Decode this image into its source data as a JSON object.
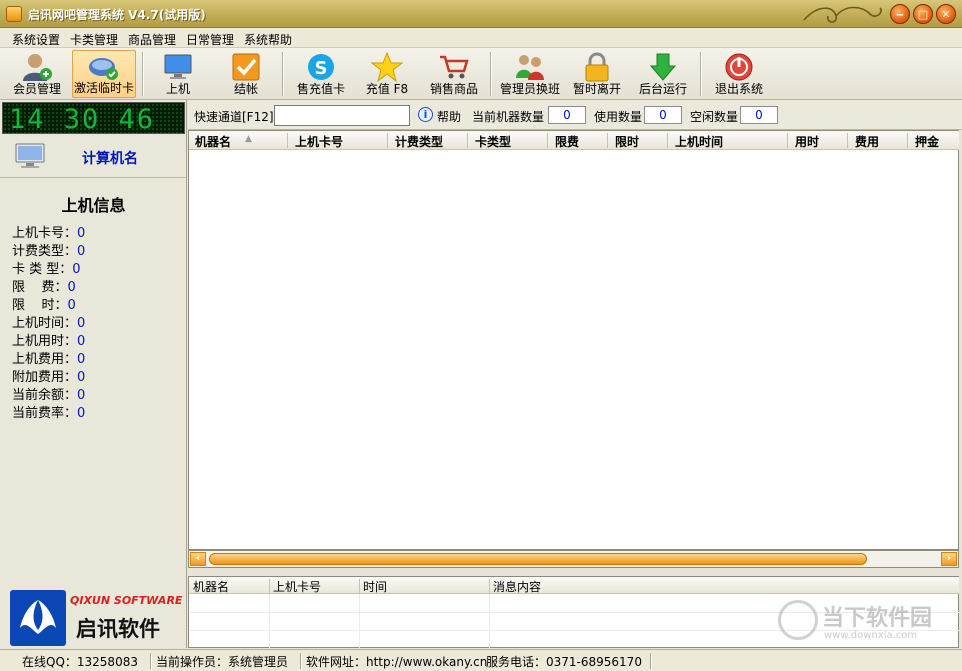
{
  "window": {
    "title": "启讯网吧管理系统 V4.7(试用版)"
  },
  "menu": {
    "items": [
      "系统设置",
      "卡类管理",
      "商品管理",
      "日常管理",
      "系统帮助"
    ]
  },
  "toolbar": {
    "buttons": [
      {
        "label": "会员管理",
        "icon": "member-icon"
      },
      {
        "label": "激活临时卡",
        "icon": "temp-card-icon"
      },
      {
        "label": "上机",
        "icon": "monitor-icon"
      },
      {
        "label": "结帐",
        "icon": "checkout-icon"
      },
      {
        "label": "售充值卡",
        "icon": "skype-icon"
      },
      {
        "label": "充值 F8",
        "icon": "star-icon"
      },
      {
        "label": "销售商品",
        "icon": "cart-icon"
      },
      {
        "label": "管理员换班",
        "icon": "admin-swap-icon"
      },
      {
        "label": "暂时离开",
        "icon": "lock-icon"
      },
      {
        "label": "后台运行",
        "icon": "arrow-down-icon"
      },
      {
        "label": "退出系统",
        "icon": "exit-icon"
      }
    ]
  },
  "clock": {
    "time": "14 30 46"
  },
  "left_panel": {
    "pc_name": "计算机名",
    "info_title": "上机信息",
    "rows": [
      {
        "label": "上机卡号：",
        "value": "0"
      },
      {
        "label": "计费类型：",
        "value": "0"
      },
      {
        "label": "卡 类 型：",
        "value": "0"
      },
      {
        "label": "限    费：",
        "value": "0"
      },
      {
        "label": "限    时：",
        "value": "0"
      },
      {
        "label": "上机时间：",
        "value": "0"
      },
      {
        "label": "上机用时：",
        "value": "0"
      },
      {
        "label": "上机费用：",
        "value": "0"
      },
      {
        "label": "附加费用：",
        "value": "0"
      },
      {
        "label": "当前余额：",
        "value": "0"
      },
      {
        "label": "当前费率：",
        "value": "0"
      }
    ],
    "logo_en": "QIXUN SOFTWARE",
    "logo_cn": "启讯软件"
  },
  "quickbar": {
    "label": "快速通道[F12]",
    "input_value": "",
    "help_label": "帮助",
    "current_label": "当前机器数量",
    "current_value": "0",
    "used_label": "使用数量",
    "used_value": "0",
    "idle_label": "空闲数量",
    "idle_value": "0"
  },
  "grid": {
    "columns": [
      "机器名",
      "上机卡号",
      "计费类型",
      "卡类型",
      "限费",
      "限时",
      "上机时间",
      "用时",
      "费用",
      "押金"
    ]
  },
  "messages": {
    "columns": [
      "机器名",
      "上机卡号",
      "时间",
      "消息内容"
    ]
  },
  "status": {
    "qq": "在线QQ：13258083",
    "operator": "当前操作员：系统管理员",
    "website": "软件网址：http://www.okany.cn",
    "phone": "服务电话：0371-68956170"
  },
  "watermark": {
    "text": "当下软件园",
    "url": "www.downxia.com"
  },
  "colors": {
    "titlebar": "#c2ad55",
    "accent_orange": "#f0931b",
    "value_blue": "#0017b5",
    "clock_green": "#13b63a"
  }
}
